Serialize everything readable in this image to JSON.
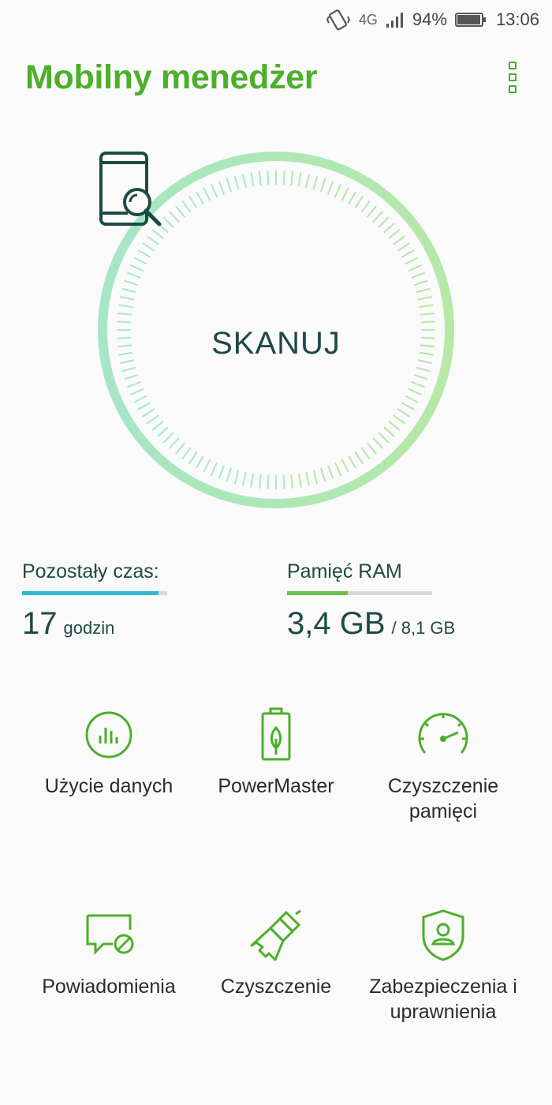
{
  "status_bar": {
    "network": "4G",
    "battery": "94%",
    "battery_level": 0.94,
    "time": "13:06",
    "icons": [
      "vibrate-icon",
      "signal-icon",
      "battery-icon"
    ]
  },
  "header": {
    "title": "Mobilny menedżer",
    "menu_icon": "overflow-menu-icon"
  },
  "colors": {
    "brand": "#4caf2a",
    "text_dark": "#1e4a45",
    "battery_bar": "#2db9d6",
    "ram_bar": "#6cc04a",
    "dial_left": "#a8e8c8",
    "dial_right": "#b4e6a8"
  },
  "scan": {
    "label": "SKANUJ",
    "icon": "phone-search-icon"
  },
  "stats": {
    "battery": {
      "label": "Pozostały czas:",
      "value": "17",
      "unit": "godzin",
      "level": 0.94
    },
    "ram": {
      "label": "Pamięć RAM",
      "value": "3,4 GB",
      "total": "/ 8,1 GB",
      "level": 0.42
    }
  },
  "tiles": [
    {
      "label": "Użycie danych",
      "icon": "data-usage-icon"
    },
    {
      "label": "PowerMaster",
      "icon": "power-master-icon"
    },
    {
      "label": "Czyszczenie pamięci",
      "icon": "speedometer-icon"
    },
    {
      "label": "Powiadomienia",
      "icon": "notification-block-icon"
    },
    {
      "label": "Czyszczenie",
      "icon": "brush-icon"
    },
    {
      "label": "Zabezpieczenia i uprawnienia",
      "icon": "shield-user-icon"
    }
  ]
}
